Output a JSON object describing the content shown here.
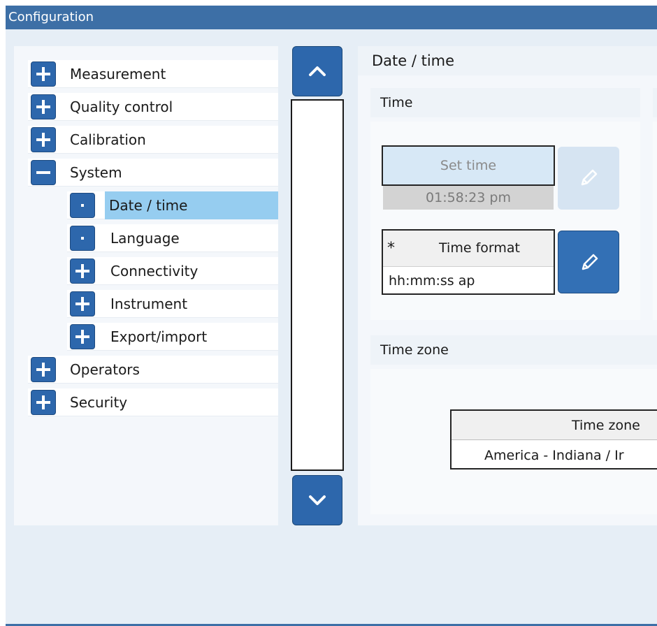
{
  "window": {
    "title": "Configuration"
  },
  "tree": {
    "items": [
      {
        "label": "Measurement",
        "control": "plus",
        "level": 0,
        "selected": false
      },
      {
        "label": "Quality control",
        "control": "plus",
        "level": 0,
        "selected": false
      },
      {
        "label": "Calibration",
        "control": "plus",
        "level": 0,
        "selected": false
      },
      {
        "label": "System",
        "control": "minus",
        "level": 0,
        "selected": false
      },
      {
        "label": "Date / time",
        "control": "dot",
        "level": 1,
        "selected": true
      },
      {
        "label": "Language",
        "control": "dot",
        "level": 1,
        "selected": false
      },
      {
        "label": "Connectivity",
        "control": "plus",
        "level": 1,
        "selected": false
      },
      {
        "label": "Instrument",
        "control": "plus",
        "level": 1,
        "selected": false
      },
      {
        "label": "Export/import",
        "control": "plus",
        "level": 1,
        "selected": false
      },
      {
        "label": "Operators",
        "control": "plus",
        "level": 0,
        "selected": false
      },
      {
        "label": "Security",
        "control": "plus",
        "level": 0,
        "selected": false
      }
    ]
  },
  "scroll": {
    "up_icon": "chevron-up-icon",
    "down_icon": "chevron-down-icon"
  },
  "panel": {
    "title": "Date / time",
    "time_group": {
      "title": "Time",
      "set_time": {
        "label": "Set time",
        "value": "01:58:23 pm",
        "enabled": false
      },
      "time_format": {
        "required_marker": "*",
        "label": "Time format",
        "value": "hh:mm:ss ap"
      },
      "edit_icon": "pencil-icon"
    },
    "timezone_group": {
      "title": "Time zone",
      "table": {
        "header": "Time zone",
        "value": "America - Indiana / Ir"
      }
    }
  },
  "colors": {
    "title_bar": "#3d6fa6",
    "tree_button": "#2d67ac",
    "selection": "#96cdf0",
    "background": "#e6eef6",
    "disabled_button": "#d7e8f6"
  }
}
